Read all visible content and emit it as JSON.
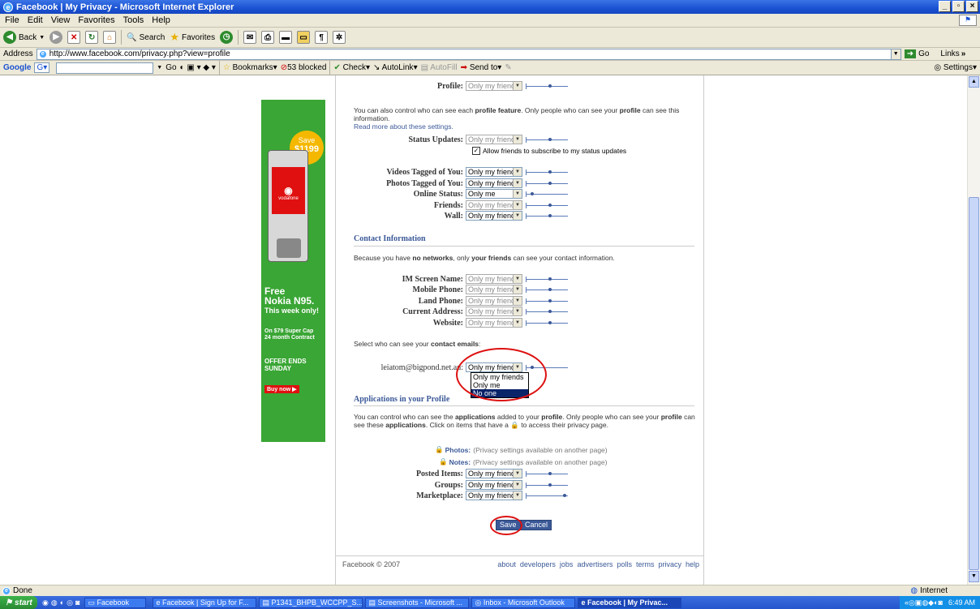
{
  "window": {
    "title": "Facebook | My Privacy - Microsoft Internet Explorer"
  },
  "menu": {
    "items": [
      "File",
      "Edit",
      "View",
      "Favorites",
      "Tools",
      "Help"
    ]
  },
  "toolbar": {
    "back": "Back",
    "search": "Search",
    "favorites": "Favorites"
  },
  "address": {
    "label": "Address",
    "url": "http://www.facebook.com/privacy.php?view=profile",
    "go": "Go",
    "links": "Links"
  },
  "googlebar": {
    "brand": "Google",
    "gc": "G",
    "go": "Go",
    "bookmarks": "Bookmarks",
    "blocked": "53 blocked",
    "check": "Check",
    "autolink": "AutoLink",
    "autofill": "AutoFill",
    "sendto": "Send to",
    "settings": "Settings"
  },
  "page": {
    "profile_row": {
      "label": "Profile:",
      "value": "Only my friends"
    },
    "profile_feature_text_1": "You can also control who can see each",
    "profile_feature_bold": "profile feature",
    "profile_feature_text_2": ". Only people who can see your",
    "profile_bold": "profile",
    "profile_feature_text_3": "can see this information.",
    "read_more": "Read more about these settings.",
    "status_row": {
      "label": "Status Updates:",
      "value": "Only my friends"
    },
    "subscribe_label": "Allow friends to subscribe to my status updates",
    "feature_rows": [
      {
        "label": "Videos Tagged of You:",
        "value": "Only my friends"
      },
      {
        "label": "Photos Tagged of You:",
        "value": "Only my friends"
      },
      {
        "label": "Online Status:",
        "value": "Only me"
      },
      {
        "label": "Friends:",
        "value": "Only my friends"
      },
      {
        "label": "Wall:",
        "value": "Only my friends"
      }
    ],
    "contact_title": "Contact Information",
    "contact_text_1": "Because you have",
    "contact_bold_1": "no networks",
    "contact_text_2": ", only",
    "contact_bold_2": "your friends",
    "contact_text_3": "can see your contact information.",
    "contact_rows": [
      {
        "label": "IM Screen Name:",
        "value": "Only my friends"
      },
      {
        "label": "Mobile Phone:",
        "value": "Only my friends"
      },
      {
        "label": "Land Phone:",
        "value": "Only my friends"
      },
      {
        "label": "Current Address:",
        "value": "Only my friends"
      },
      {
        "label": "Website:",
        "value": "Only my friends"
      }
    ],
    "emails_text": "Select who can see your",
    "emails_bold": "contact emails",
    "emails_colon": ":",
    "email_row": {
      "label": "leiatom@bigpond.net.au:",
      "value": "Only my friends"
    },
    "email_options": [
      "Only my friends",
      "Only me",
      "No one"
    ],
    "email_highlighted": "No one",
    "apps_title": "Applications in your Profile",
    "apps_text_1": "You can control who can see the",
    "apps_bold_1": "applications",
    "apps_text_2": "added to your",
    "apps_bold_2": "profile",
    "apps_text_3": ". Only people who can see your",
    "apps_bold_3": "profile",
    "apps_text_4": "can see these",
    "apps_bold_4": "applications",
    "apps_text_5": ". Click on items that have a",
    "apps_text_6": "to access their privacy page.",
    "photos_link": {
      "label": "Photos:",
      "note": "(Privacy settings available on another page)"
    },
    "notes_link": {
      "label": "Notes:",
      "note": "(Privacy settings available on another page)"
    },
    "app_rows": [
      {
        "label": "Posted Items:",
        "value": "Only my friends"
      },
      {
        "label": "Groups:",
        "value": "Only my friends"
      },
      {
        "label": "Marketplace:",
        "value": "Only my friends"
      }
    ],
    "save": "Save",
    "cancel": "Cancel",
    "copyright": "Facebook © 2007",
    "footer_links": [
      "about",
      "developers",
      "jobs",
      "advertisers",
      "polls",
      "terms",
      "privacy",
      "help"
    ]
  },
  "ad": {
    "save_word": "Save",
    "save_amount": "$1199",
    "carrier": "vodafone",
    "headline_1": "Free",
    "headline_2": "Nokia N95.",
    "headline_3": "This week only!",
    "plan_1": "On $79 Super Cap",
    "plan_2": "24 month Contract",
    "ends_1": "OFFER ENDS",
    "ends_2": "SUNDAY",
    "buy": "Buy now"
  },
  "status": {
    "text": "Done",
    "zone": "Internet"
  },
  "taskbar": {
    "start": "start",
    "tasks": [
      "Facebook",
      "Facebook | Sign Up for F...",
      "P1341_BHPB_WCCPP_S...",
      "Screenshots - Microsoft ...",
      "Inbox - Microsoft Outlook",
      "Facebook | My Privac..."
    ],
    "clock": "6:49 AM"
  },
  "colors": {
    "fb_blue": "#3b5998",
    "ad_green": "#3aa635",
    "annotation_red": "#d11111"
  }
}
